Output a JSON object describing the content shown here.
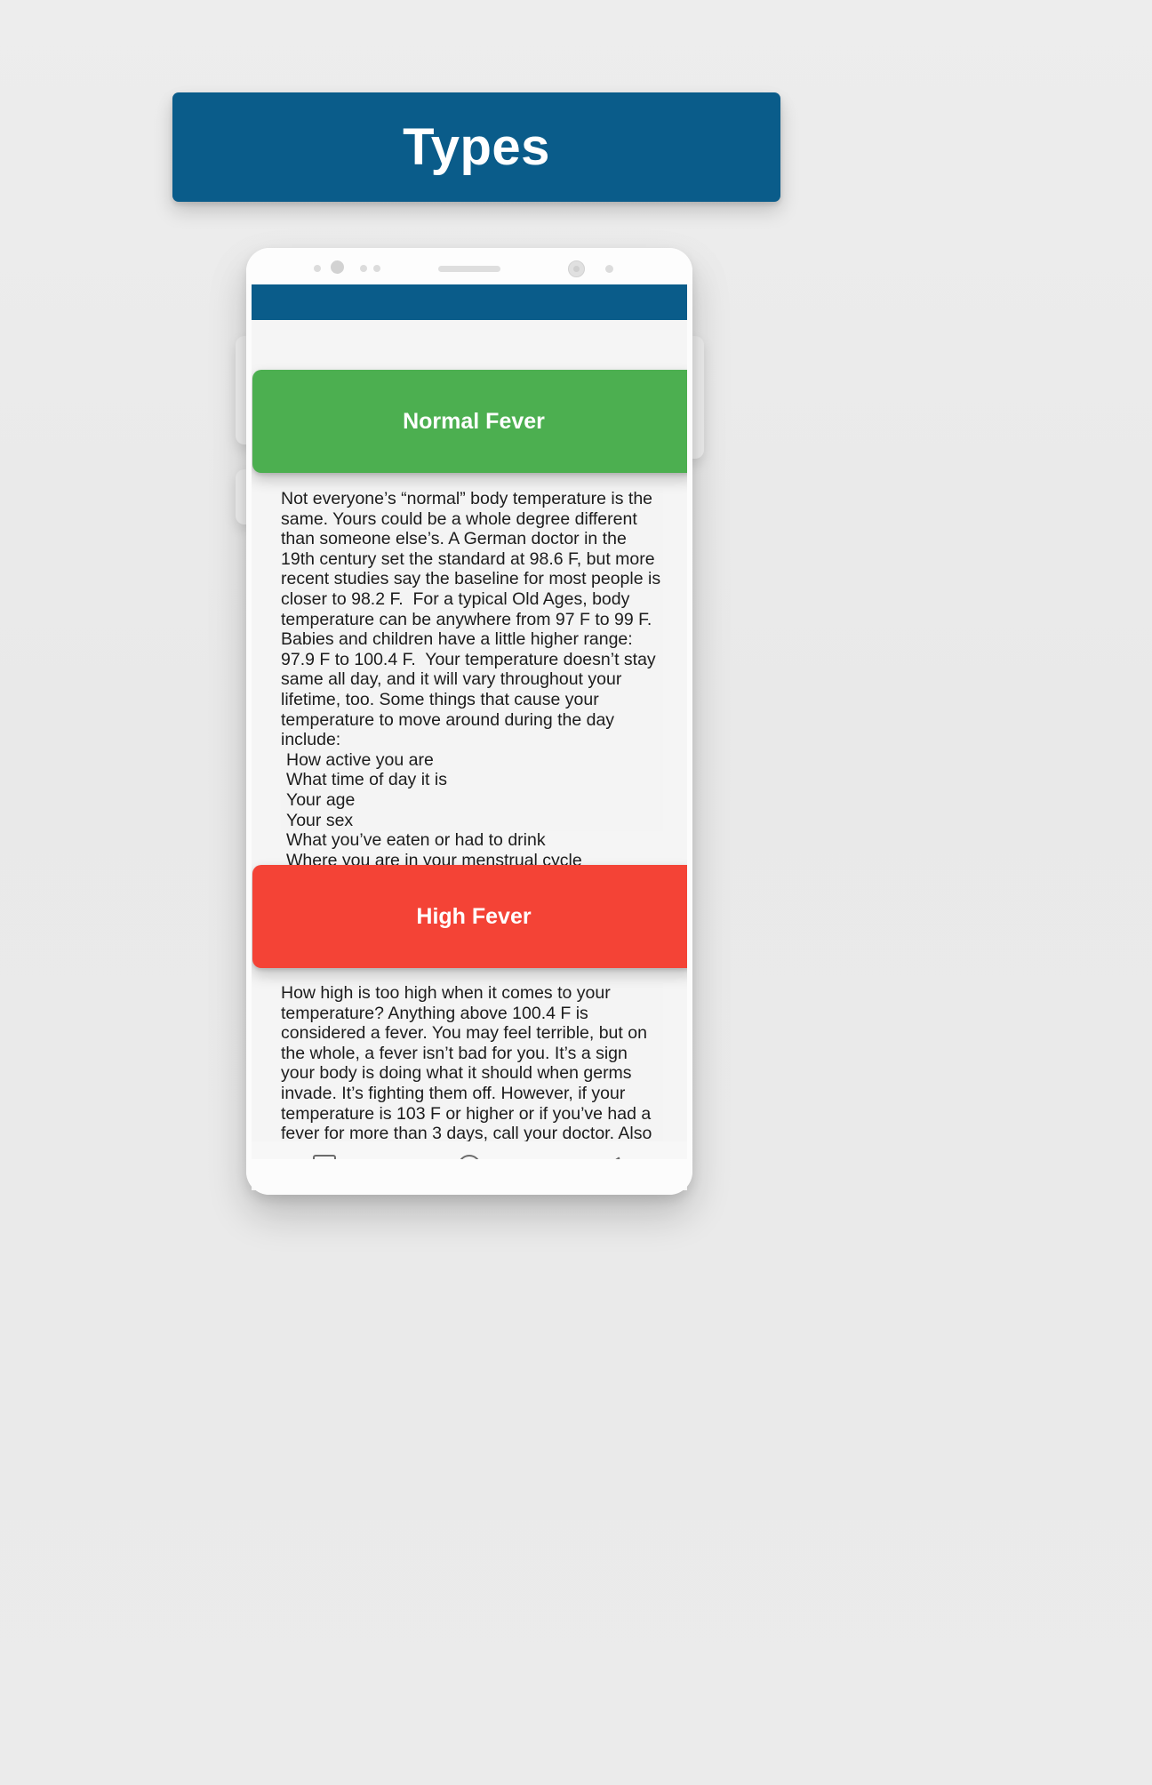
{
  "page": {
    "background_color": "#ececec"
  },
  "title_banner": {
    "text": "Types",
    "background_color": "#0a5c8a",
    "text_color": "#ffffff"
  },
  "phone": {
    "icons": {
      "sensor_a": "proximity-sensor-icon",
      "sensor_b": "light-sensor-icon",
      "sensor_c": "sensor-icon",
      "sensor_d": "sensor-icon",
      "earpiece": "earpiece-speaker-icon",
      "front_camera": "front-camera-icon",
      "sensor_e": "led-indicator-icon"
    },
    "app_bar": {
      "background_color": "#0a5c8a"
    },
    "nav_bar": {
      "recent_label": "recent-apps",
      "home_label": "home",
      "back_label": "back"
    }
  },
  "sections": [
    {
      "id": "normal-fever",
      "header_label": "Normal Fever",
      "header_color": "#4caf50",
      "expanded": true,
      "paragraph": "Not everyone’s “normal” body temperature is the same. Yours could be a whole degree different than someone else’s. A German doctor in the 19th century set the standard at 98.6 F, but more recent studies say the baseline for most people is closer to 98.2 F.  For a typical Old Ages, body temperature can be anywhere from 97 F to 99 F. Babies and children have a little higher range: 97.9 F to 100.4 F.  Your temperature doesn’t stay same all day, and it will vary throughout your lifetime, too. Some things that cause your temperature to move around during the day include:",
      "list": [
        "How active you are",
        "What time of day it is",
        "Your age",
        "Your sex",
        "What you’ve eaten or had to drink",
        "Where you are in your menstrual cycle"
      ]
    },
    {
      "id": "high-fever",
      "header_label": "High Fever",
      "header_color": "#f44336",
      "expanded": true,
      "paragraph": "How high is too high when it comes to your temperature? Anything above 100.4 F is considered a fever. You may feel terrible, but on the whole, a fever isn’t bad for you. It’s a sign your body is doing what it should when germs invade. It’s fighting them off. However, if your temperature is 103 F or higher or if you’ve had a fever for more than 3 days, call your doctor. Also call if you have a fever with symptoms like",
      "list": []
    }
  ]
}
